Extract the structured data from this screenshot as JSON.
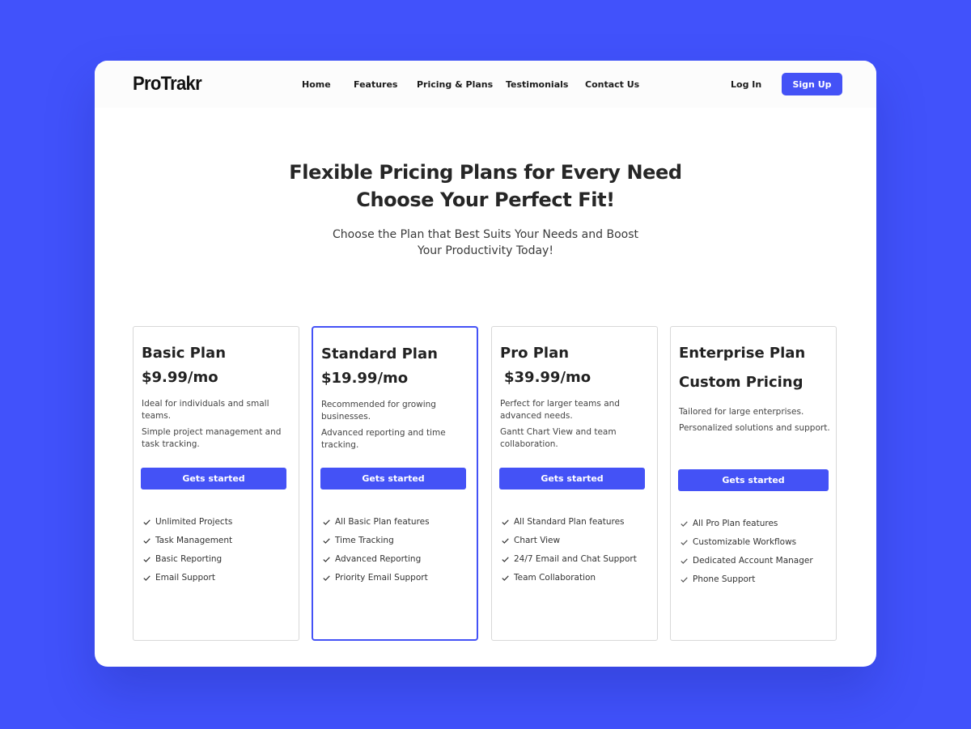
{
  "colors": {
    "background": "#4152fb",
    "accent": "#4452f6",
    "card_featured_border": "#4452f6"
  },
  "navbar": {
    "logo": "ProTrakr",
    "links": [
      "Home",
      "Features",
      "Pricing & Plans",
      "Testimonials",
      "Contact Us"
    ],
    "login_label": "Log In",
    "signup_label": "Sign Up"
  },
  "hero": {
    "title": "Flexible Pricing Plans for Every Need Choose Your Perfect Fit!",
    "subtitle": "Choose the Plan that Best Suits Your Needs and Boost Your Productivity Today!"
  },
  "plans": [
    {
      "name": "Basic Plan",
      "price": "$9.99/mo",
      "descriptions": [
        "Ideal for individuals and small teams.",
        "Simple project management and task tracking."
      ],
      "cta": "Gets started",
      "features": [
        "Unlimited Projects",
        "Task Management",
        "Basic Reporting",
        "Email Support"
      ],
      "featured": false
    },
    {
      "name": "Standard Plan",
      "price": "$19.99/mo",
      "descriptions": [
        "Recommended for growing businesses.",
        "Advanced reporting and time tracking."
      ],
      "cta": "Gets started",
      "features": [
        "All Basic Plan features",
        "Time Tracking",
        "Advanced Reporting",
        "Priority Email Support"
      ],
      "featured": true
    },
    {
      "name": "Pro Plan",
      "price": "$39.99/mo",
      "descriptions": [
        "Perfect for larger teams and advanced needs.",
        "Gantt Chart View and team collaboration."
      ],
      "cta": "Gets started",
      "features": [
        "All Standard Plan features",
        "Chart View",
        "24/7 Email and Chat Support",
        "Team Collaboration"
      ],
      "featured": false
    },
    {
      "name": "Enterprise Plan",
      "price": "Custom Pricing",
      "descriptions": [
        "Tailored for large enterprises.",
        "Personalized solutions and support."
      ],
      "cta": "Gets started",
      "features": [
        "All Pro Plan features",
        "Customizable Workflows",
        "Dedicated Account Manager",
        "Phone Support"
      ],
      "featured": false
    }
  ]
}
